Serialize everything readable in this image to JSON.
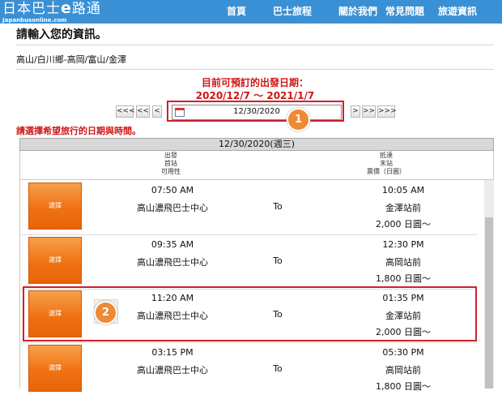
{
  "header": {
    "logo_text": "日本巴士",
    "logo_e": "e",
    "logo_tail": "路通",
    "logo_sub": "Japanbusonline.com",
    "nav": [
      "首頁",
      "巴士旅程",
      "關於我們",
      "常見問題",
      "旅遊資訊"
    ]
  },
  "page": {
    "title": "請輸入您的資訊。",
    "route": "高山/白川鄉-高岡/富山/金澤",
    "available_label": "目前可預訂的出發日期：",
    "available_range": "2020/12/7 ～ 2021/1/7",
    "warning": "請選擇希望旅行的日期與時間。"
  },
  "date_nav": {
    "prev3": "<<<",
    "prev2": "<<",
    "prev1": "<",
    "date_value": "12/30/2020",
    "next1": ">",
    "next2": ">>",
    "next3": ">>>",
    "icon": "calendar-icon"
  },
  "annotations": {
    "badge1": "1",
    "badge2": "2"
  },
  "table": {
    "date_header": "12/30/2020(週三)",
    "dep_header": [
      "出發",
      "首站",
      "可用性"
    ],
    "arr_header": [
      "抵達",
      "末站",
      "票價（日圓）"
    ],
    "select_label": "選擇",
    "to_label": "To",
    "rows": [
      {
        "dep_time": "07:50 AM",
        "dep_station": "高山濃飛巴士中心",
        "arr_time": "10:05 AM",
        "arr_station": "金澤站前",
        "price": "2,000 日圓～"
      },
      {
        "dep_time": "09:35 AM",
        "dep_station": "高山濃飛巴士中心",
        "arr_time": "12:30 PM",
        "arr_station": "高岡站前",
        "price": "1,800 日圓～"
      },
      {
        "dep_time": "11:20 AM",
        "dep_station": "高山濃飛巴士中心",
        "arr_time": "01:35 PM",
        "arr_station": "金澤站前",
        "price": "2,000 日圓～"
      },
      {
        "dep_time": "03:15 PM",
        "dep_station": "高山濃飛巴士中心",
        "arr_time": "05:30 PM",
        "arr_station": "高岡站前",
        "price": "1,800 日圓～"
      }
    ]
  },
  "colors": {
    "header_bg": "#3a90d4",
    "accent_red": "#d01515",
    "select_orange": "#ef7212"
  }
}
